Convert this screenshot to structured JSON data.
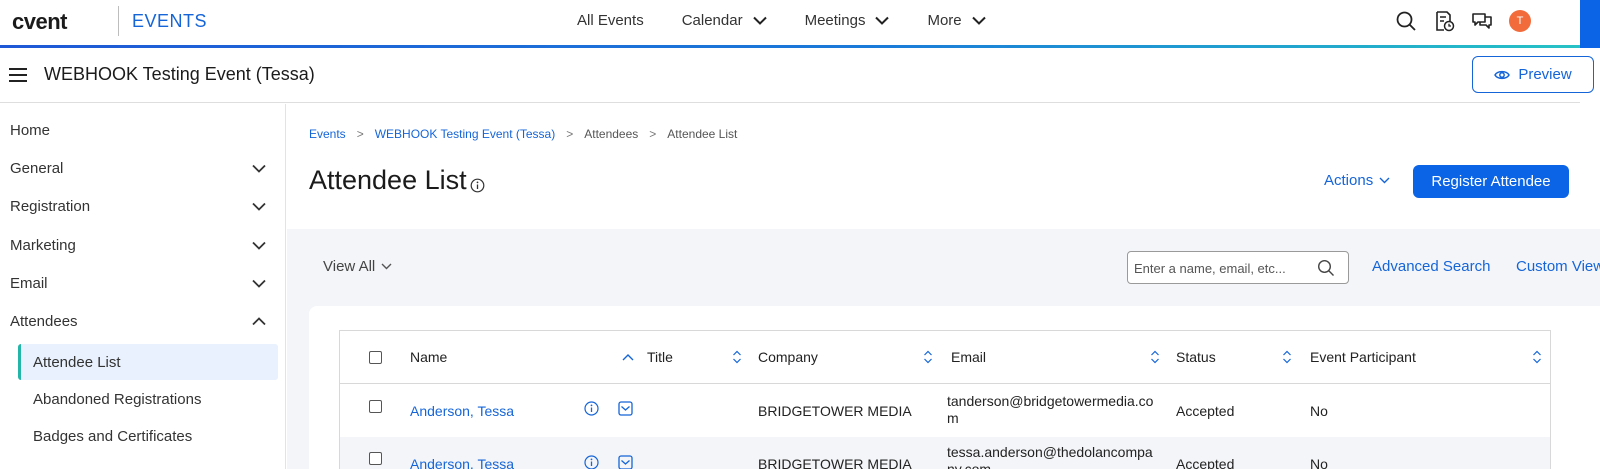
{
  "topbar": {
    "brand": "cvent",
    "product": "EVENTS",
    "nav": [
      {
        "label": "All Events",
        "dropdown": false
      },
      {
        "label": "Calendar",
        "dropdown": true
      },
      {
        "label": "Meetings",
        "dropdown": true
      },
      {
        "label": "More",
        "dropdown": true
      }
    ],
    "icons": [
      "search-icon",
      "event-doc-icon",
      "chat-icon"
    ],
    "avatar_initial": "T",
    "accent_color": "#0b63e5",
    "avatar_color": "#f26b3a"
  },
  "event": {
    "title": "WEBHOOK Testing Event (Tessa)",
    "preview_label": "Preview"
  },
  "sidebar": {
    "items": [
      {
        "label": "Home",
        "expandable": false
      },
      {
        "label": "General",
        "expandable": true,
        "expanded": false
      },
      {
        "label": "Registration",
        "expandable": true,
        "expanded": false
      },
      {
        "label": "Marketing",
        "expandable": true,
        "expanded": false
      },
      {
        "label": "Email",
        "expandable": true,
        "expanded": false
      },
      {
        "label": "Attendees",
        "expandable": true,
        "expanded": true
      }
    ],
    "subitems": [
      {
        "label": "Attendee List",
        "active": true
      },
      {
        "label": "Abandoned Registrations",
        "active": false
      },
      {
        "label": "Badges and Certificates",
        "active": false
      }
    ],
    "active_color": "#23b5a8"
  },
  "breadcrumb": [
    {
      "label": "Events",
      "link": true
    },
    {
      "label": "WEBHOOK Testing Event (Tessa)",
      "link": true
    },
    {
      "label": "Attendees",
      "link": false
    },
    {
      "label": "Attendee List",
      "link": false
    }
  ],
  "page": {
    "title": "Attendee List",
    "actions_label": "Actions",
    "register_label": "Register Attendee"
  },
  "filters": {
    "view_label": "View All",
    "search_placeholder": "Enter a name, email, etc...",
    "advanced_search_label": "Advanced Search",
    "custom_view_label": "Custom View"
  },
  "table": {
    "columns": [
      "Name",
      "Title",
      "Company",
      "Email",
      "Status",
      "Event Participant"
    ],
    "rows": [
      {
        "name": "Anderson, Tessa",
        "title": "",
        "company": "BRIDGETOWER MEDIA",
        "email": "tanderson@bridgetowermedia.com",
        "status": "Accepted",
        "participant": "No"
      },
      {
        "name": "Anderson, Tessa",
        "title": "",
        "company": "BRIDGETOWER MEDIA",
        "email": "tessa.anderson@thedolancompany.com",
        "status": "Accepted",
        "participant": "No"
      }
    ]
  }
}
